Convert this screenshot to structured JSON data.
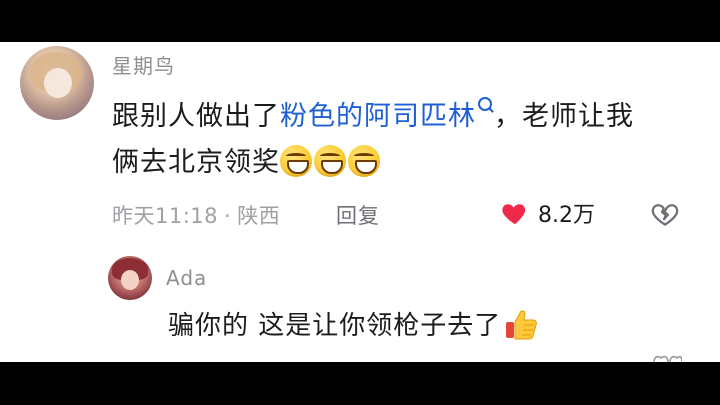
{
  "comment": {
    "username": "星期鸟",
    "text_before": "跟别人做出了",
    "link_text": "粉色的阿司匹林",
    "text_after_line1": "，老师让我",
    "text_line2": "俩去北京领奖",
    "emojis": [
      "grinning-face",
      "grinning-face",
      "grinning-face"
    ],
    "time": "昨天11:18",
    "separator": "·",
    "location": "陕西",
    "reply_label": "回复",
    "like_count": "8.2万"
  },
  "reply": {
    "username": "Ada",
    "text": "骗你的 这是让你领枪子去了"
  },
  "colors": {
    "link": "#1f5fd6",
    "heart": "#f0284a",
    "meta_gray": "#a0a0a5",
    "text": "#1c1c1e"
  },
  "icons": {
    "search": "search-icon",
    "like": "heart-icon",
    "dislike": "broken-heart-icon",
    "thumbs_up": "thumbs-up-icon"
  }
}
